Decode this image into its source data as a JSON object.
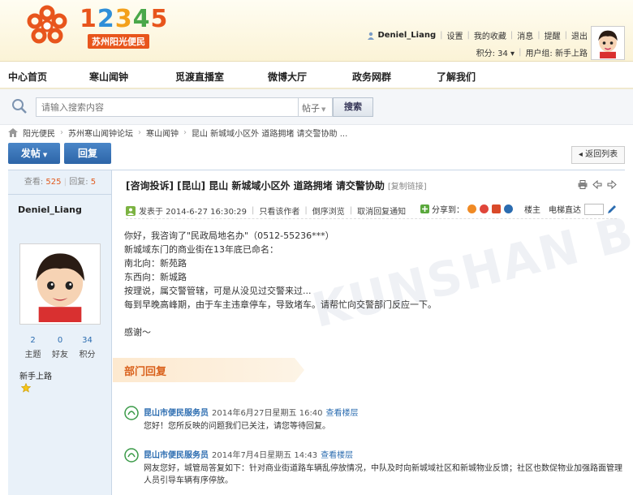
{
  "brand": {
    "logo_digits": [
      "1",
      "2",
      "3",
      "4",
      "5"
    ],
    "logo_sub": "苏州阳光便民",
    "colors": {
      "orange": "#e8551c",
      "blue": "#2f8fd8",
      "yellow": "#f3a01b",
      "green": "#4aa84a"
    }
  },
  "usernav": {
    "username": "Deniel_Liang",
    "links": [
      "设置",
      "我的收藏",
      "消息",
      "提醒",
      "退出"
    ],
    "points": "积分: 34",
    "group": "用户组: 新手上路"
  },
  "mainnav": [
    "中心首页",
    "寒山闻钟",
    "觅渡直播室",
    "微博大厅",
    "政务网群",
    "了解我们"
  ],
  "search": {
    "placeholder": "请输入搜索内容",
    "type": "帖子",
    "button": "搜索"
  },
  "breadcrumb": [
    "阳光便民",
    "苏州寒山闻钟论坛",
    "寒山闻钟",
    "昆山 新城域小区外 道路拥堵 请交警协助 ..."
  ],
  "actions": {
    "post": "发帖",
    "reply": "回复",
    "back": "返回列表"
  },
  "sidebar": {
    "views_label": "查看:",
    "views": "525",
    "replies_label": "回复:",
    "replies": "5",
    "name": "Deniel_Liang",
    "counts": [
      {
        "num": "2",
        "label": "主题"
      },
      {
        "num": "0",
        "label": "好友"
      },
      {
        "num": "34",
        "label": "积分"
      }
    ],
    "rank": "新手上路"
  },
  "post": {
    "title": "[咨询投诉] [昆山] 昆山 新城域小区外 道路拥堵 请交警协助",
    "copy_link": "[复制链接]",
    "posted": "发表于 2014-6-27 16:30:29",
    "meta_links": [
      "只看该作者",
      "倒序浏览",
      "取消回复通知"
    ],
    "share_label": "分享到：",
    "floor": "楼主",
    "jump_label": "电梯直达",
    "body": [
      "你好，我咨询了\"民政局地名办\"（0512-55236***）",
      "新城域东门的商业街在13年底已命名：",
      "南北向：新苑路",
      "东西向：新城路",
      "按理说，属交警管辖，可是从没见过交警来过...",
      "每到早晚高峰期，由于车主违章停车，导致堵车。请帮忙向交警部门反应一下。",
      "",
      "感谢～"
    ],
    "watermark": "KUNSHAN BBS"
  },
  "dept": {
    "label": "部门回复",
    "replies": [
      {
        "dept": "昆山市便民服务员",
        "date": "2014年6月27日星期五 16:40",
        "link": "查看楼层",
        "text": "您好！您所反映的问题我们已关注，请您等待回复。"
      },
      {
        "dept": "昆山市便民服务员",
        "date": "2014年7月4日星期五 14:43",
        "link": "查看楼层",
        "text": "网友您好，城管局答复如下：针对商业街道路车辆乱停放情况，中队及时向新城域社区和新城物业反馈；社区也数促物业加强路面管理人员引导车辆有序停放。"
      }
    ]
  }
}
